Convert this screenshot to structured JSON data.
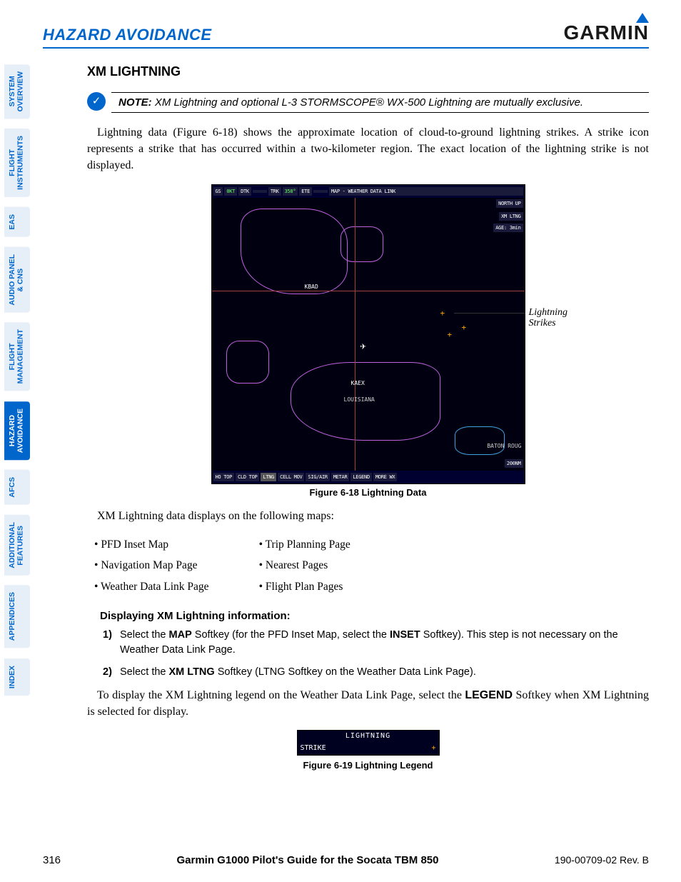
{
  "header": {
    "section": "HAZARD AVOIDANCE",
    "logo": "GARMIN"
  },
  "sidebar": [
    {
      "label": "SYSTEM\nOVERVIEW",
      "current": false
    },
    {
      "label": "FLIGHT\nINSTRUMENTS",
      "current": false
    },
    {
      "label": "EAS",
      "current": false
    },
    {
      "label": "AUDIO PANEL\n& CNS",
      "current": false
    },
    {
      "label": "FLIGHT\nMANAGEMENT",
      "current": false
    },
    {
      "label": "HAZARD\nAVOIDANCE",
      "current": true
    },
    {
      "label": "AFCS",
      "current": false
    },
    {
      "label": "ADDITIONAL\nFEATURES",
      "current": false
    },
    {
      "label": "APPENDICES",
      "current": false
    },
    {
      "label": "INDEX",
      "current": false
    }
  ],
  "h2": "XM LIGHTNING",
  "note": {
    "label": "NOTE:",
    "text": "XM Lightning and optional L-3 STORMSCOPE® WX-500 Lightning are mutually exclusive."
  },
  "para1": "Lightning data (Figure 6-18) shows the approximate location of cloud-to-ground lightning strikes.  A strike icon represents a strike that has occurred within a two-kilometer region.  The exact location of the lightning strike is not displayed.",
  "fig1": {
    "topbar": {
      "gs": "GS",
      "gs_val": "0KT",
      "dtk": "DTK",
      "trk": "TRK",
      "trk_val": "358°",
      "ete": "ETE",
      "title": "MAP - WEATHER DATA LINK",
      "north": "NORTH UP",
      "xm": "XM LTNG",
      "age": "AGE: 3min"
    },
    "waypoints": {
      "kbad": "KBAD",
      "kaex": "KAEX",
      "louisiana": "LOUISIANA",
      "baton": "BATON ROUG"
    },
    "range": "200NM",
    "botbar": [
      "HO TOP",
      "CLD TOP",
      "LTNG",
      "CELL MOV",
      "SIG/AIR",
      "METAR",
      "LEGEND",
      "MORE WX"
    ],
    "callout": "Lightning\nStrikes",
    "caption": "Figure 6-18  Lightning Data"
  },
  "para2": "XM Lightning data displays on the following maps:",
  "list_left": [
    "PFD Inset Map",
    "Navigation Map Page",
    "Weather Data Link Page"
  ],
  "list_right": [
    "Trip Planning Page",
    "Nearest Pages",
    "Flight Plan Pages"
  ],
  "steps_head": "Displaying XM Lightning information:",
  "steps": [
    {
      "n": "1)",
      "pre": "Select the ",
      "k1": "MAP",
      "mid": " Softkey (for the PFD Inset Map, select the ",
      "k2": "INSET",
      "post": " Softkey).  This step is not necessary on the Weather Data Link Page."
    },
    {
      "n": "2)",
      "pre": "Select the ",
      "k1": "XM LTNG",
      "mid": " Softkey (LTNG Softkey on the Weather Data Link Page).",
      "k2": "",
      "post": ""
    }
  ],
  "para3_pre": "To display the XM Lightning legend on the Weather Data Link Page, select the ",
  "para3_key": "LEGEND",
  "para3_post": " Softkey when XM Lightning is selected for display.",
  "fig2": {
    "title": "LIGHTNING",
    "row_label": "STRIKE",
    "caption": "Figure 6-19  Lightning Legend"
  },
  "footer": {
    "page": "316",
    "guide": "Garmin G1000 Pilot's Guide for the Socata TBM 850",
    "rev": "190-00709-02   Rev. B"
  }
}
